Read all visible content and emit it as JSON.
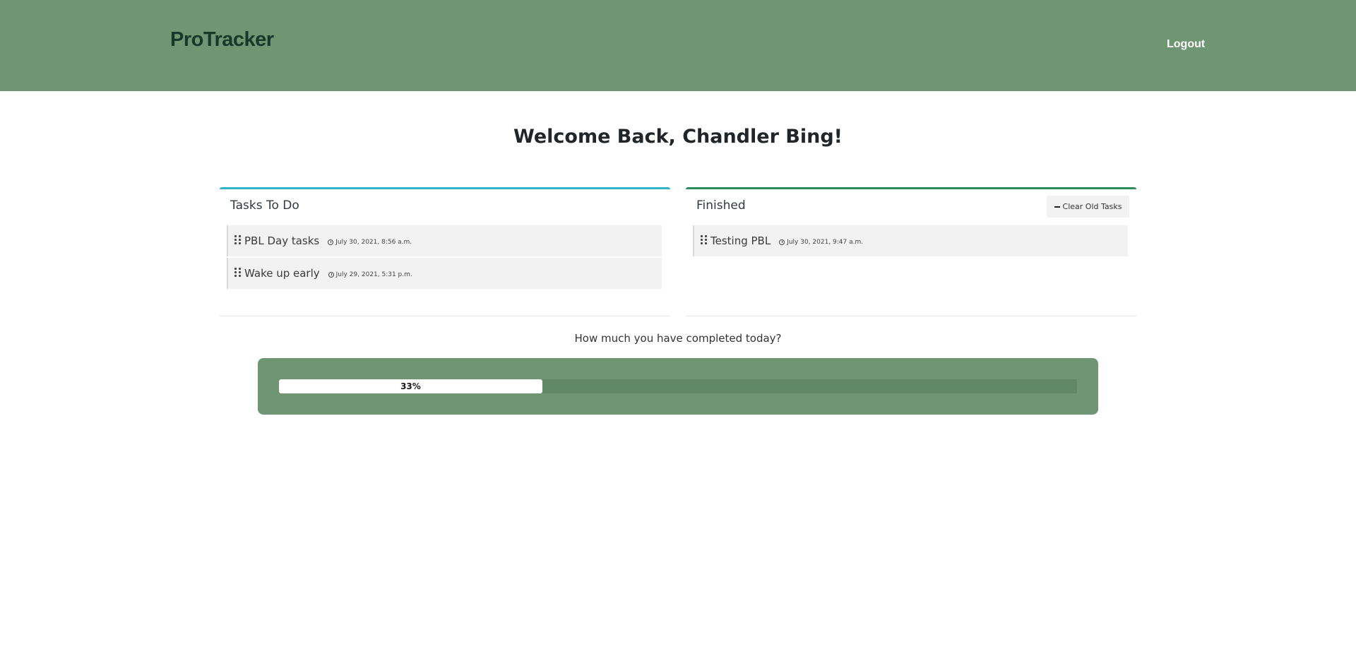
{
  "header": {
    "logo": "ProTracker",
    "logout_label": "Logout"
  },
  "welcome": "Welcome Back, Chandler Bing!",
  "todo": {
    "title": "Tasks To Do",
    "tasks": [
      {
        "name": "PBL Day tasks",
        "time": "July 30, 2021, 8:56 a.m."
      },
      {
        "name": "Wake up early",
        "time": "July 29, 2021, 5:31 p.m."
      }
    ]
  },
  "finished": {
    "title": "Finished",
    "clear_label": "Clear Old Tasks",
    "tasks": [
      {
        "name": "Testing PBL",
        "time": "July 30, 2021, 9:47 a.m."
      }
    ]
  },
  "progress": {
    "label": "How much you have completed today?",
    "value_text": "33%",
    "fraction": 0.33
  },
  "colors": {
    "header_bg": "#6e9673",
    "logo": "#16392a",
    "todo_accent": "#33b1cb",
    "finished_accent": "#2f8a5e"
  },
  "icons": {
    "drag": "grip-vertical-icon",
    "time": "clock-icon",
    "clear": "minus-icon"
  }
}
